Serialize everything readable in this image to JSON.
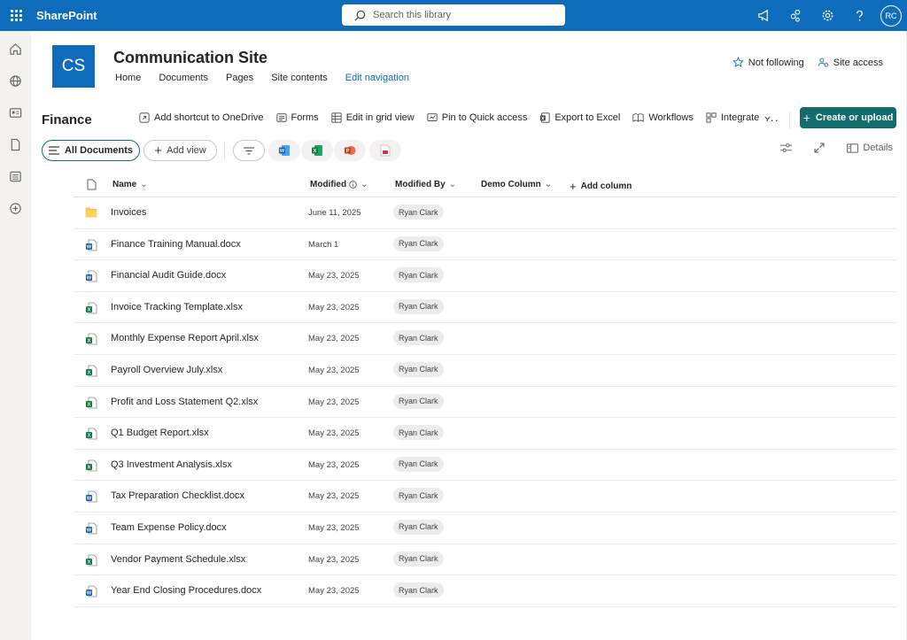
{
  "suite": {
    "brand": "SharePoint",
    "search_placeholder": "Search this library",
    "avatar_initials": "RC"
  },
  "site": {
    "logo_text": "CS",
    "title": "Communication Site",
    "nav": [
      "Home",
      "Documents",
      "Pages",
      "Site contents",
      "Edit navigation"
    ],
    "follow_label": "Not following",
    "access_label": "Site access"
  },
  "commandbar": {
    "library_title": "Finance",
    "add_shortcut": "Add shortcut to OneDrive",
    "forms": "Forms",
    "edit_grid": "Edit in grid view",
    "pin": "Pin to Quick access",
    "export": "Export to Excel",
    "workflows": "Workflows",
    "integrate": "Integrate",
    "more": "···",
    "create": "Create or upload"
  },
  "viewbar": {
    "all_documents": "All Documents",
    "add_view": "Add view",
    "details": "Details"
  },
  "table": {
    "headers": {
      "name": "Name",
      "modified": "Modified",
      "modified_by": "Modified By",
      "demo_column": "Demo Column",
      "add_column": "Add column"
    },
    "rows": [
      {
        "type": "folder",
        "name": "Invoices",
        "modified": "June 11, 2025",
        "modified_by": "Ryan Clark"
      },
      {
        "type": "docx",
        "name": "Finance Training Manual.docx",
        "modified": "March 1",
        "modified_by": "Ryan Clark"
      },
      {
        "type": "docx",
        "name": "Financial Audit Guide.docx",
        "modified": "May 23, 2025",
        "modified_by": "Ryan Clark"
      },
      {
        "type": "xlsx",
        "name": "Invoice Tracking Template.xlsx",
        "modified": "May 23, 2025",
        "modified_by": "Ryan Clark"
      },
      {
        "type": "xlsx",
        "name": "Monthly Expense Report April.xlsx",
        "modified": "May 23, 2025",
        "modified_by": "Ryan Clark"
      },
      {
        "type": "xlsx",
        "name": "Payroll Overview July.xlsx",
        "modified": "May 23, 2025",
        "modified_by": "Ryan Clark"
      },
      {
        "type": "xlsx",
        "name": "Profit and Loss Statement Q2.xlsx",
        "modified": "May 23, 2025",
        "modified_by": "Ryan Clark"
      },
      {
        "type": "xlsx",
        "name": "Q1 Budget Report.xlsx",
        "modified": "May 23, 2025",
        "modified_by": "Ryan Clark"
      },
      {
        "type": "xlsx",
        "name": "Q3 Investment Analysis.xlsx",
        "modified": "May 23, 2025",
        "modified_by": "Ryan Clark"
      },
      {
        "type": "docx",
        "name": "Tax Preparation Checklist.docx",
        "modified": "May 23, 2025",
        "modified_by": "Ryan Clark"
      },
      {
        "type": "docx",
        "name": "Team Expense Policy.docx",
        "modified": "May 23, 2025",
        "modified_by": "Ryan Clark"
      },
      {
        "type": "xlsx",
        "name": "Vendor Payment Schedule.xlsx",
        "modified": "May 23, 2025",
        "modified_by": "Ryan Clark"
      },
      {
        "type": "docx",
        "name": "Year End Closing Procedures.docx",
        "modified": "May 23, 2025",
        "modified_by": "Ryan Clark"
      }
    ]
  },
  "colors": {
    "suite_blue": "#0f6cbd",
    "accent_teal": "#116c6b",
    "word_blue": "#185abd",
    "excel_green": "#107c41",
    "folder_yellow": "#f8c23a"
  }
}
